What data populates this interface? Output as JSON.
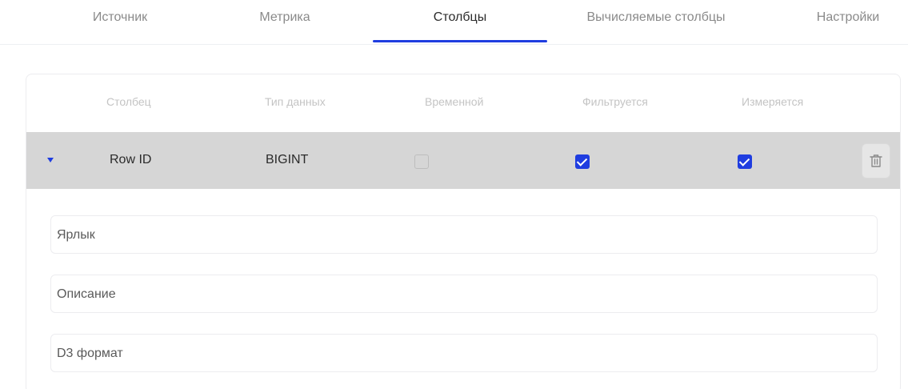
{
  "tabs": [
    {
      "label": "Источник",
      "active": false
    },
    {
      "label": "Метрика",
      "active": false
    },
    {
      "label": "Столбцы",
      "active": true
    },
    {
      "label": "Вычисляемые столбцы",
      "active": false
    },
    {
      "label": "Настройки",
      "active": false
    }
  ],
  "table": {
    "headers": [
      "Столбец",
      "Тип данных",
      "Временной",
      "Фильтруется",
      "Измеряется"
    ],
    "rows": [
      {
        "column": "Row ID",
        "type": "BIGINT",
        "temporal": false,
        "filterable": true,
        "measurable": true,
        "expanded": true
      }
    ]
  },
  "details": {
    "label_field": "Ярлык",
    "description_field": "Описание",
    "d3_format_field": "D3 формат"
  },
  "colors": {
    "accent": "#1f3de0",
    "row_background": "#d6d6d6"
  },
  "icons": {
    "expand": "caret-down-icon",
    "delete": "trash-icon"
  }
}
